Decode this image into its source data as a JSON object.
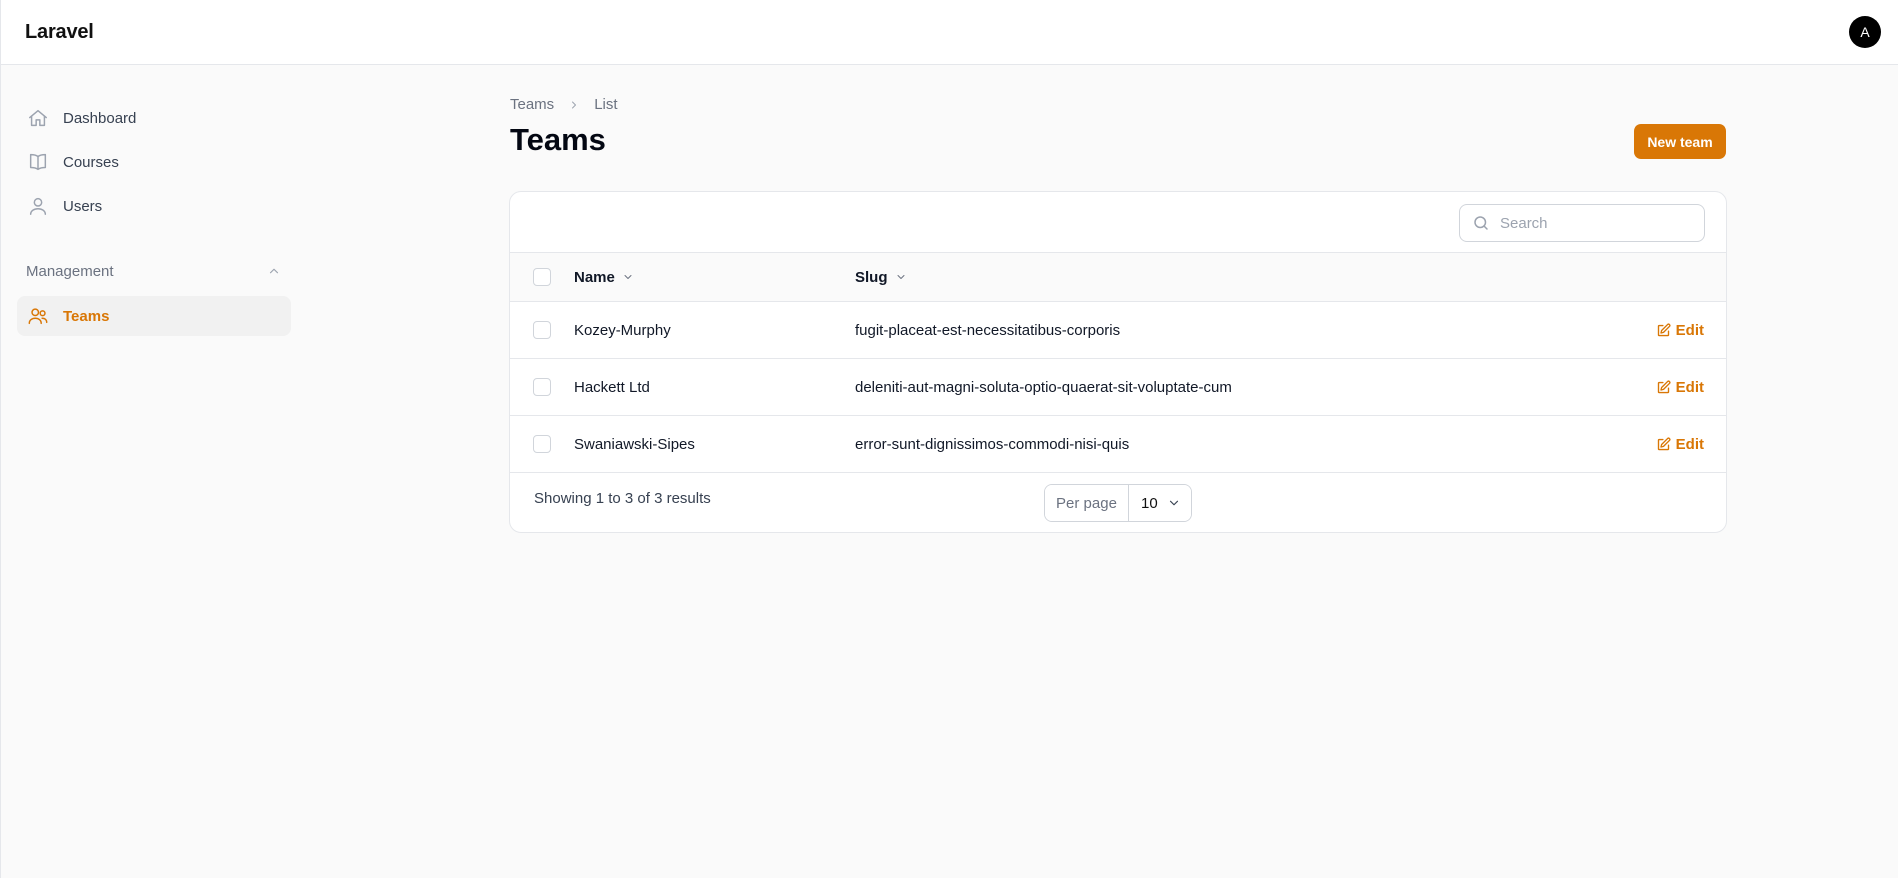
{
  "app": {
    "brand": "Laravel",
    "user_initial": "A"
  },
  "sidebar": {
    "items": [
      {
        "label": "Dashboard",
        "icon": "home-icon"
      },
      {
        "label": "Courses",
        "icon": "book-icon"
      },
      {
        "label": "Users",
        "icon": "user-icon"
      }
    ],
    "group": {
      "label": "Management",
      "items": [
        {
          "label": "Teams",
          "icon": "users-icon",
          "active": true
        }
      ]
    }
  },
  "header": {
    "breadcrumb": [
      "Teams",
      "List"
    ],
    "title": "Teams",
    "new_button": "New team"
  },
  "table": {
    "search_placeholder": "Search",
    "columns": [
      "Name",
      "Slug"
    ],
    "rows": [
      {
        "name": "Kozey-Murphy",
        "slug": "fugit-placeat-est-necessitatibus-corporis",
        "action": "Edit"
      },
      {
        "name": "Hackett Ltd",
        "slug": "deleniti-aut-magni-soluta-optio-quaerat-sit-voluptate-cum",
        "action": "Edit"
      },
      {
        "name": "Swaniawski-Sipes",
        "slug": "error-sunt-dignissimos-commodi-nisi-quis",
        "action": "Edit"
      }
    ],
    "footer": {
      "summary": "Showing 1 to 3 of 3 results",
      "per_page_label": "Per page",
      "per_page_value": "10"
    }
  },
  "colors": {
    "accent": "#d97706",
    "background": "#fafafa"
  }
}
